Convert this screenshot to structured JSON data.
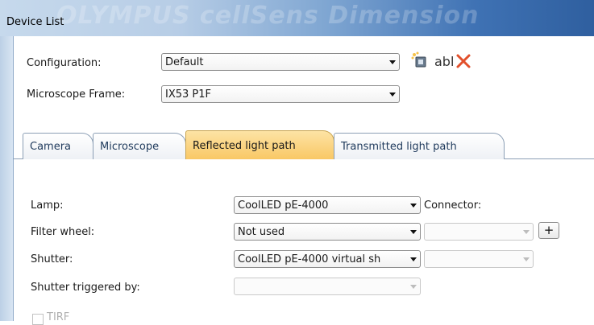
{
  "window": {
    "title": "Device List",
    "watermark": "OLYMPUS cellSens Dimension"
  },
  "config": {
    "configuration_label": "Configuration:",
    "configuration_value": "Default",
    "frame_label": "Microscope Frame:",
    "frame_value": "IX53 P1F",
    "rename_text": "abl"
  },
  "tabs": [
    {
      "label": "Camera",
      "active": false
    },
    {
      "label": "Microscope",
      "active": false
    },
    {
      "label": "Reflected light path",
      "active": true
    },
    {
      "label": "Transmitted light path",
      "active": false
    }
  ],
  "form": {
    "lamp_label": "Lamp:",
    "lamp_value": "CoolLED pE-4000",
    "connector_label": "Connector:",
    "filter_label": "Filter wheel:",
    "filter_value": "Not used",
    "plus_label": "+",
    "shutter_label": "Shutter:",
    "shutter_value": "CoolLED pE-4000 virtual sh",
    "trigger_label": "Shutter triggered by:",
    "tirf_label": "TIRF"
  },
  "colors": {
    "active_tab": "#f9c865",
    "delete_icon": "#e2502b",
    "title_gradient_end": "#2f5f9f"
  }
}
